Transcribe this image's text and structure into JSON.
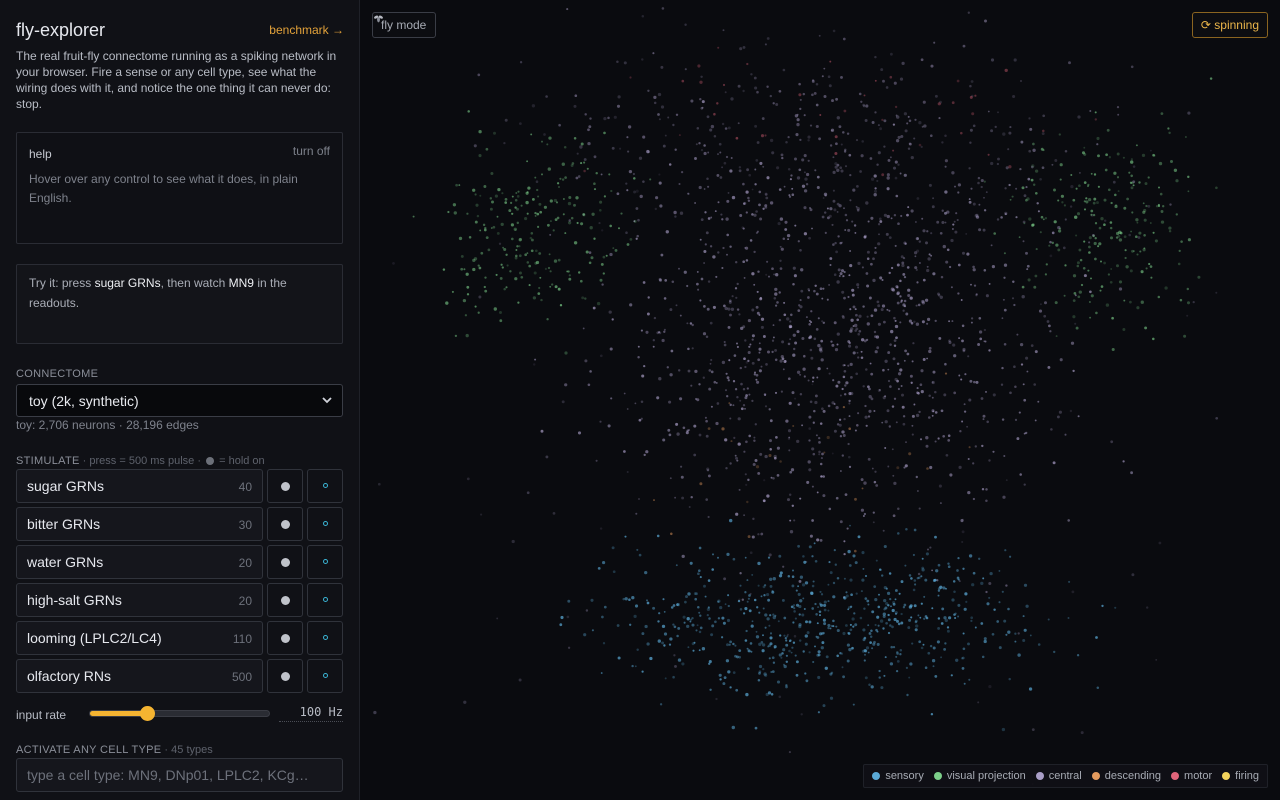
{
  "sidebar": {
    "title": "fly-explorer",
    "benchmark_link": "benchmark →",
    "intro": "The real fruit-fly connectome running as a spiking network in your browser. Fire a sense or any cell type, see what the wiring does with it, and notice the one thing it can never do: stop.",
    "help": {
      "title": "help",
      "turn_off": "turn off",
      "text": "Hover over any control to see what it does, in plain English."
    },
    "tip": {
      "prefix": "Try it: press ",
      "highlight1": "sugar GRNs",
      "middle": ", then watch ",
      "highlight2": "MN9",
      "suffix": " in the readouts."
    },
    "connectome": {
      "label": "CONNECTOME",
      "selected": "toy (2k, synthetic)",
      "stats": "toy: 2,706 neurons · 28,196 edges"
    },
    "stimulate": {
      "label": "STIMULATE",
      "hint": " · press = 500 ms pulse · ",
      "hint_hold": " = hold on",
      "items": [
        {
          "label": "sugar GRNs",
          "count": "40"
        },
        {
          "label": "bitter GRNs",
          "count": "30"
        },
        {
          "label": "water GRNs",
          "count": "20"
        },
        {
          "label": "high-salt GRNs",
          "count": "20"
        },
        {
          "label": "looming (LPLC2/LC4)",
          "count": "110"
        },
        {
          "label": "olfactory RNs",
          "count": "500"
        }
      ]
    },
    "input_rate": {
      "label": "input rate",
      "value": "100 Hz",
      "fraction": 0.32
    },
    "cell_type": {
      "label": "ACTIVATE ANY CELL TYPE",
      "hint": " · 45 types",
      "placeholder": "type a cell type: MN9, DNp01, LPLC2, KCg…"
    }
  },
  "viewport": {
    "fly_mode": "fly mode",
    "spinning": "spinning",
    "legend": [
      {
        "label": "sensory",
        "color": "#5aa9d6"
      },
      {
        "label": "visual projection",
        "color": "#7ccf8a"
      },
      {
        "label": "central",
        "color": "#a99ec7"
      },
      {
        "label": "descending",
        "color": "#e39a5e"
      },
      {
        "label": "motor",
        "color": "#e0647a"
      },
      {
        "label": "firing",
        "color": "#f2d35c"
      }
    ]
  },
  "colors": {
    "accent": "#e3a23a",
    "slider": "#f5b431",
    "pulse_icon": "#3ab4d4"
  }
}
